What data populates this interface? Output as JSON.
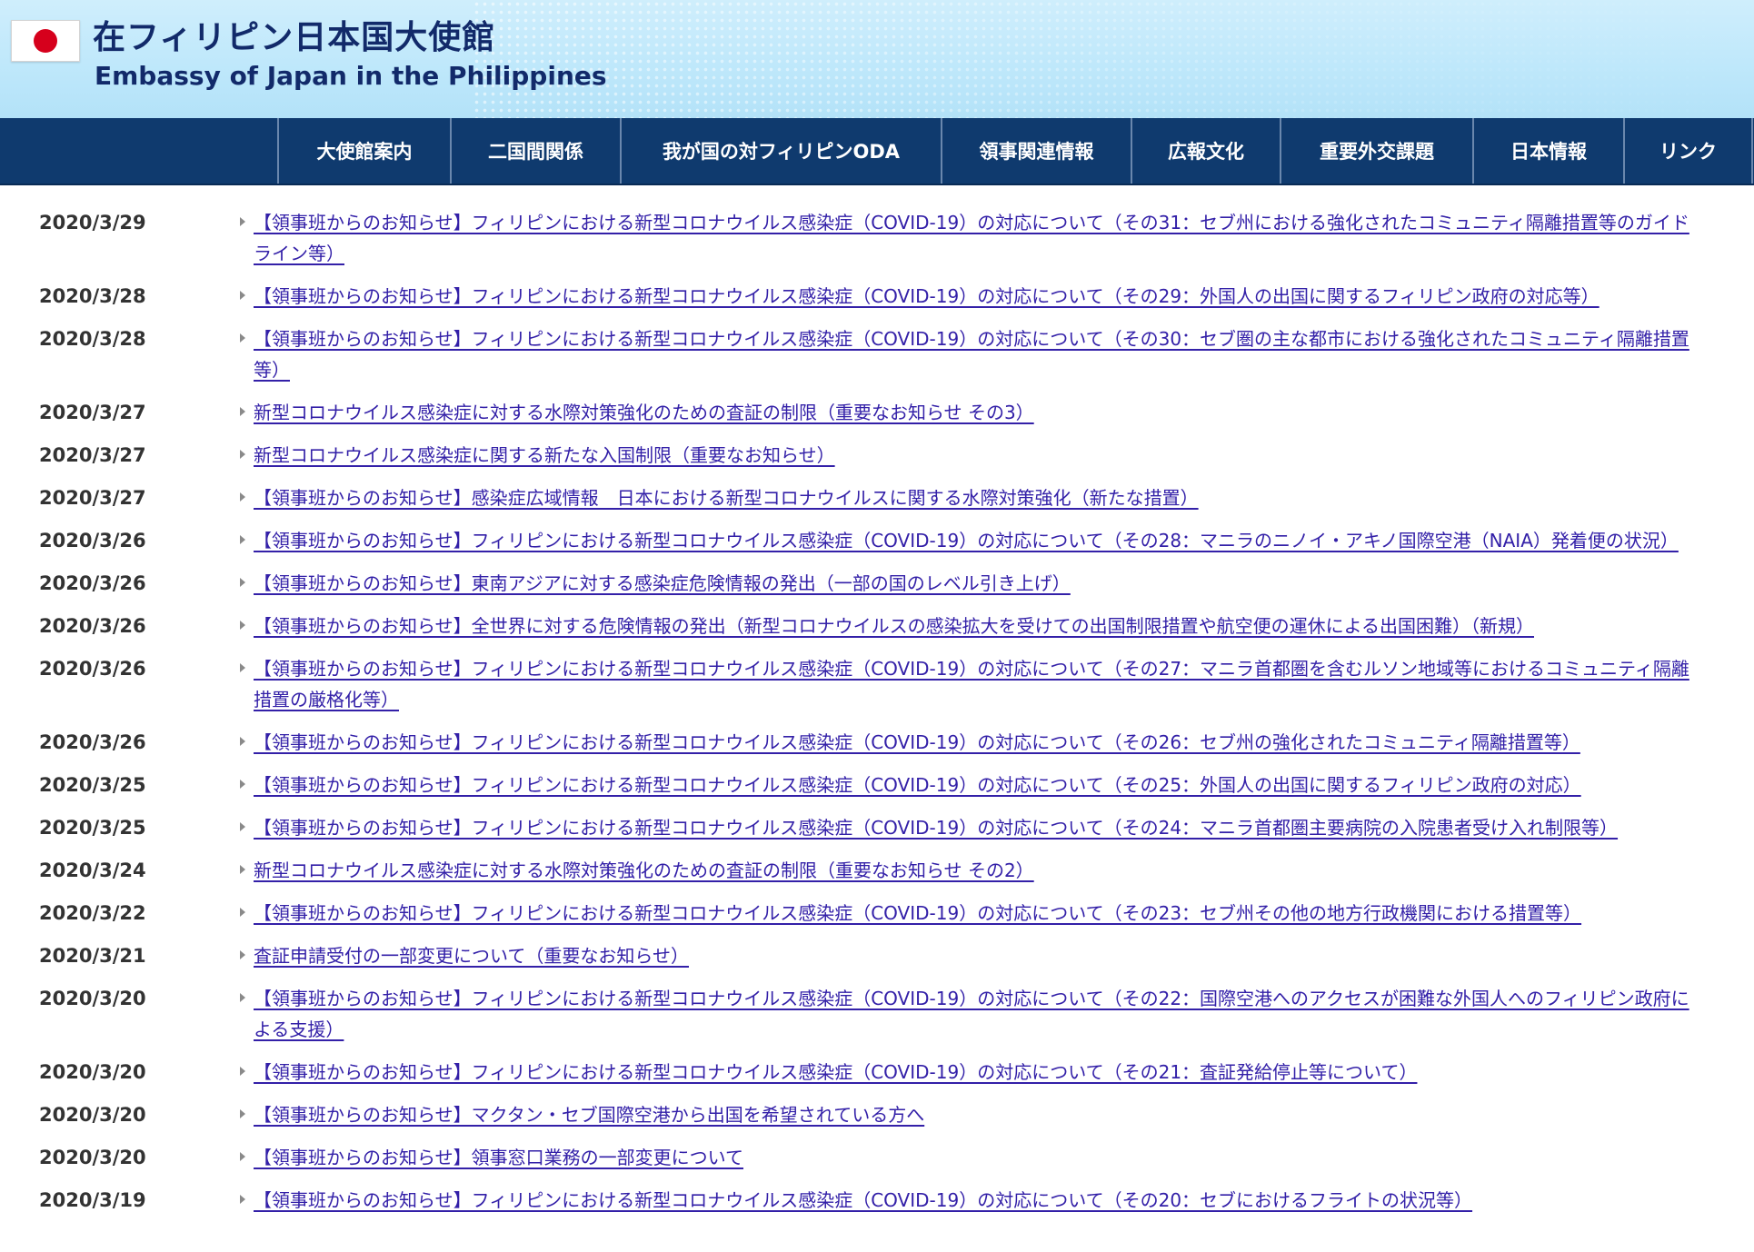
{
  "header": {
    "title_ja": "在フィリピン日本国大使館",
    "title_en": "Embassy of Japan in the Philippines",
    "flag_icon": "japan-flag-icon",
    "colors": {
      "title": "#122a6a",
      "flag_disc": "#d6001c",
      "background": "#bfe8fb"
    }
  },
  "nav": {
    "background": "#0f3a6e",
    "items": [
      {
        "label": "大使館案内"
      },
      {
        "label": "二国間関係"
      },
      {
        "label": "我が国の対フィリピンODA"
      },
      {
        "label": "領事関連情報"
      },
      {
        "label": "広報文化"
      },
      {
        "label": "重要外交課題"
      },
      {
        "label": "日本情報"
      },
      {
        "label": "リンク"
      }
    ]
  },
  "news": {
    "bullet_icon": "triangle-right-icon",
    "link_color": "#3320a8",
    "items": [
      {
        "date": "2020/3/29",
        "title": "【領事班からのお知らせ】フィリピンにおける新型コロナウイルス感染症（COVID-19）の対応について（その31：セブ州における強化されたコミュニティ隔離措置等のガイドライン等）"
      },
      {
        "date": "2020/3/28",
        "title": "【領事班からのお知らせ】フィリピンにおける新型コロナウイルス感染症（COVID-19）の対応について（その29：外国人の出国に関するフィリピン政府の対応等）"
      },
      {
        "date": "2020/3/28",
        "title": "【領事班からのお知らせ】フィリピンにおける新型コロナウイルス感染症（COVID-19）の対応について（その30：セブ圏の主な都市における強化されたコミュニティ隔離措置等）"
      },
      {
        "date": "2020/3/27",
        "title": "新型コロナウイルス感染症に対する水際対策強化のための査証の制限（重要なお知らせ その3）"
      },
      {
        "date": "2020/3/27",
        "title": "新型コロナウイルス感染症に関する新たな入国制限（重要なお知らせ）"
      },
      {
        "date": "2020/3/27",
        "title": "【領事班からのお知らせ】感染症広域情報　日本における新型コロナウイルスに関する水際対策強化（新たな措置）"
      },
      {
        "date": "2020/3/26",
        "title": "【領事班からのお知らせ】フィリピンにおける新型コロナウイルス感染症（COVID-19）の対応について（その28：マニラのニノイ・アキノ国際空港（NAIA）発着便の状況）"
      },
      {
        "date": "2020/3/26",
        "title": "【領事班からのお知らせ】東南アジアに対する感染症危険情報の発出（一部の国のレベル引き上げ）"
      },
      {
        "date": "2020/3/26",
        "title": "【領事班からのお知らせ】全世界に対する危険情報の発出（新型コロナウイルスの感染拡大を受けての出国制限措置や航空便の運休による出国困難）（新規）"
      },
      {
        "date": "2020/3/26",
        "title": "【領事班からのお知らせ】フィリピンにおける新型コロナウイルス感染症（COVID-19）の対応について（その27：マニラ首都圏を含むルソン地域等におけるコミュニティ隔離措置の厳格化等）"
      },
      {
        "date": "2020/3/26",
        "title": "【領事班からのお知らせ】フィリピンにおける新型コロナウイルス感染症（COVID-19）の対応について（その26：セブ州の強化されたコミュニティ隔離措置等）"
      },
      {
        "date": "2020/3/25",
        "title": "【領事班からのお知らせ】フィリピンにおける新型コロナウイルス感染症（COVID-19）の対応について（その25：外国人の出国に関するフィリピン政府の対応）"
      },
      {
        "date": "2020/3/25",
        "title": "【領事班からのお知らせ】フィリピンにおける新型コロナウイルス感染症（COVID-19）の対応について（その24：マニラ首都圏主要病院の入院患者受け入れ制限等）"
      },
      {
        "date": "2020/3/24",
        "title": "新型コロナウイルス感染症に対する水際対策強化のための査証の制限（重要なお知らせ その2）"
      },
      {
        "date": "2020/3/22",
        "title": "【領事班からのお知らせ】フィリピンにおける新型コロナウイルス感染症（COVID-19）の対応について（その23：セブ州その他の地方行政機関における措置等）"
      },
      {
        "date": "2020/3/21",
        "title": "査証申請受付の一部変更について（重要なお知らせ）"
      },
      {
        "date": "2020/3/20",
        "title": "【領事班からのお知らせ】フィリピンにおける新型コロナウイルス感染症（COVID-19）の対応について（その22：国際空港へのアクセスが困難な外国人へのフィリピン政府による支援）"
      },
      {
        "date": "2020/3/20",
        "title": "【領事班からのお知らせ】フィリピンにおける新型コロナウイルス感染症（COVID-19）の対応について（その21：査証発給停止等について）"
      },
      {
        "date": "2020/3/20",
        "title": "【領事班からのお知らせ】マクタン・セブ国際空港から出国を希望されている方へ"
      },
      {
        "date": "2020/3/20",
        "title": "【領事班からのお知らせ】領事窓口業務の一部変更について"
      },
      {
        "date": "2020/3/19",
        "title": "【領事班からのお知らせ】フィリピンにおける新型コロナウイルス感染症（COVID-19）の対応について（その20：セブにおけるフライトの状況等）"
      }
    ]
  }
}
